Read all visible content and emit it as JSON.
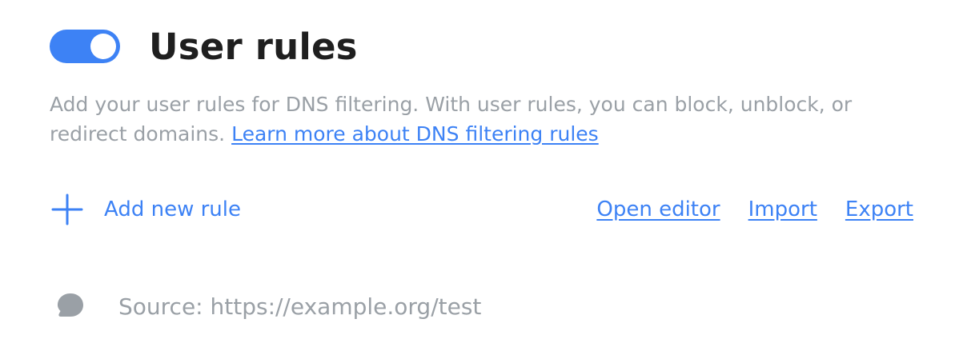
{
  "header": {
    "title": "User rules",
    "toggle_on": true
  },
  "description": {
    "text": "Add your user rules for DNS filtering. With user rules, you can block, unblock, or redirect domains. ",
    "link_label": "Learn more about DNS filtering rules"
  },
  "actions": {
    "add_rule_label": "Add new rule",
    "open_editor_label": "Open editor",
    "import_label": "Import",
    "export_label": "Export"
  },
  "rules": [
    {
      "text": "Source: https://example.org/test",
      "icon": "comment-icon"
    }
  ],
  "colors": {
    "accent": "#3d82f5",
    "muted": "#9aa0a6",
    "title": "#1f1f1f"
  }
}
